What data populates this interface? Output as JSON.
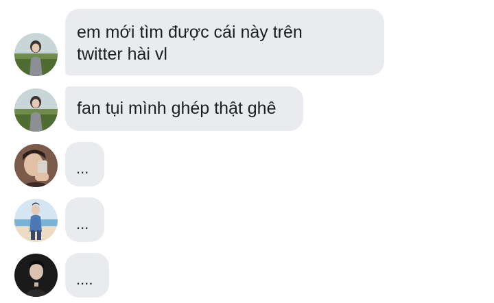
{
  "messages": [
    {
      "sender": "user-1",
      "avatar_icon": "profile-photo-girl-in-field",
      "lines": [
        "em mới tìm được cái này trên",
        "twitter hài vl"
      ]
    },
    {
      "sender": "user-1",
      "avatar_icon": "profile-photo-girl-in-field",
      "lines": [
        "fan tụi mình ghép thật ghê"
      ]
    },
    {
      "sender": "user-2",
      "avatar_icon": "profile-photo-selfie-with-phone",
      "text": "..."
    },
    {
      "sender": "user-3",
      "avatar_icon": "profile-photo-beach",
      "text": "..."
    },
    {
      "sender": "user-4",
      "avatar_icon": "profile-photo-dark-portrait",
      "text": "...."
    }
  ],
  "colors": {
    "bubble_background": "#e9ebee",
    "text": "#1c1e21",
    "page_background": "#ffffff"
  }
}
